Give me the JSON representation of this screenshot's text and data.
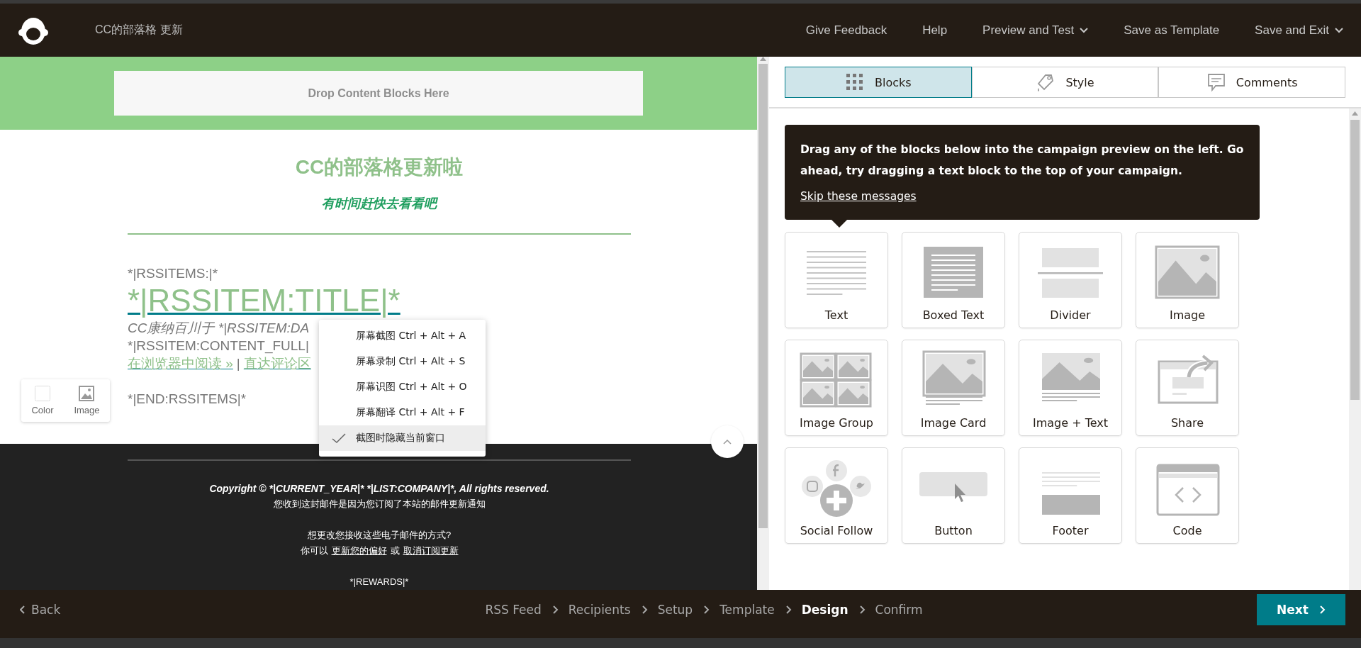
{
  "app_bar": {
    "title": "CC的部落格 更新",
    "actions": [
      {
        "label": "Give Feedback",
        "dropdown": false
      },
      {
        "label": "Help",
        "dropdown": false
      },
      {
        "label": "Preview and Test",
        "dropdown": true
      },
      {
        "label": "Save as Template",
        "dropdown": false
      },
      {
        "label": "Save and Exit",
        "dropdown": true
      }
    ]
  },
  "preview": {
    "drop_zone": "Drop Content Blocks Here",
    "heading": "CC的部落格更新啦",
    "subheading": "有时间赶快去看看吧",
    "lines": [
      {
        "kind": "plain",
        "text": "*|RSSITEMS:|*"
      },
      {
        "kind": "title",
        "text": "*|RSSITEM:TITLE|*"
      },
      {
        "kind": "meta",
        "text": "CC康纳百川于  *|RSSITEM:DA"
      },
      {
        "kind": "plain",
        "text": "*|RSSITEM:CONTENT_FULL|"
      },
      {
        "kind": "links",
        "links": [
          "在浏览器中阅读 »",
          "直达评论区"
        ],
        "separator": "|"
      },
      {
        "kind": "gap"
      },
      {
        "kind": "plain",
        "text": "*|END:RSSITEMS|*"
      }
    ],
    "footer": {
      "copyright": "Copyright © *|CURRENT_YEAR|* *|LIST:COMPANY|*, All rights reserved.",
      "reason": "您收到这封邮件是因为您订阅了本站的邮件更新通知",
      "question": "想更改您接收这些电子邮件的方式?",
      "prefix": "你可以",
      "link_1": "更新您的偏好",
      "joiner": "或",
      "link_2": "取消订阅更新",
      "rewards": "*|REWARDS|*"
    },
    "float_toolbar": [
      "Color",
      "Image"
    ]
  },
  "context_menu": [
    {
      "label": "屏幕截图 Ctrl + Alt + A",
      "checked": false
    },
    {
      "label": "屏幕录制 Ctrl + Alt + S",
      "checked": false
    },
    {
      "label": "屏幕识图 Ctrl + Alt + O",
      "checked": false
    },
    {
      "label": "屏幕翻译 Ctrl + Alt + F",
      "checked": false
    },
    {
      "label": "截图时隐藏当前窗口",
      "checked": true
    }
  ],
  "panel": {
    "tabs": [
      {
        "label": "Blocks",
        "kind": "blocks",
        "selected": true
      },
      {
        "label": "Style",
        "kind": "style",
        "selected": false
      },
      {
        "label": "Comments",
        "kind": "comments",
        "selected": false
      }
    ],
    "tip": {
      "text": "Drag any of the blocks below into the campaign preview on the left. Go ahead, try dragging a text block to the top of your campaign.",
      "link": "Skip these messages"
    },
    "blocks": [
      {
        "label": "Text",
        "kind": "text"
      },
      {
        "label": "Boxed Text",
        "kind": "boxed"
      },
      {
        "label": "Divider",
        "kind": "divider"
      },
      {
        "label": "Image",
        "kind": "image"
      },
      {
        "label": "Image Group",
        "kind": "group"
      },
      {
        "label": "Image Card",
        "kind": "card"
      },
      {
        "label": "Image + Text",
        "kind": "imagetext"
      },
      {
        "label": "Share",
        "kind": "share"
      },
      {
        "label": "Social Follow",
        "kind": "social"
      },
      {
        "label": "Button",
        "kind": "button"
      },
      {
        "label": "Footer",
        "kind": "footer"
      },
      {
        "label": "Code",
        "kind": "code"
      }
    ]
  },
  "wizard": {
    "back": "Back",
    "steps": [
      {
        "label": "RSS Feed",
        "selected": false
      },
      {
        "label": "Recipients",
        "selected": false
      },
      {
        "label": "Setup",
        "selected": false
      },
      {
        "label": "Template",
        "selected": false
      },
      {
        "label": "Design",
        "selected": true
      },
      {
        "label": "Confirm",
        "selected": false
      }
    ],
    "next": "Next"
  }
}
